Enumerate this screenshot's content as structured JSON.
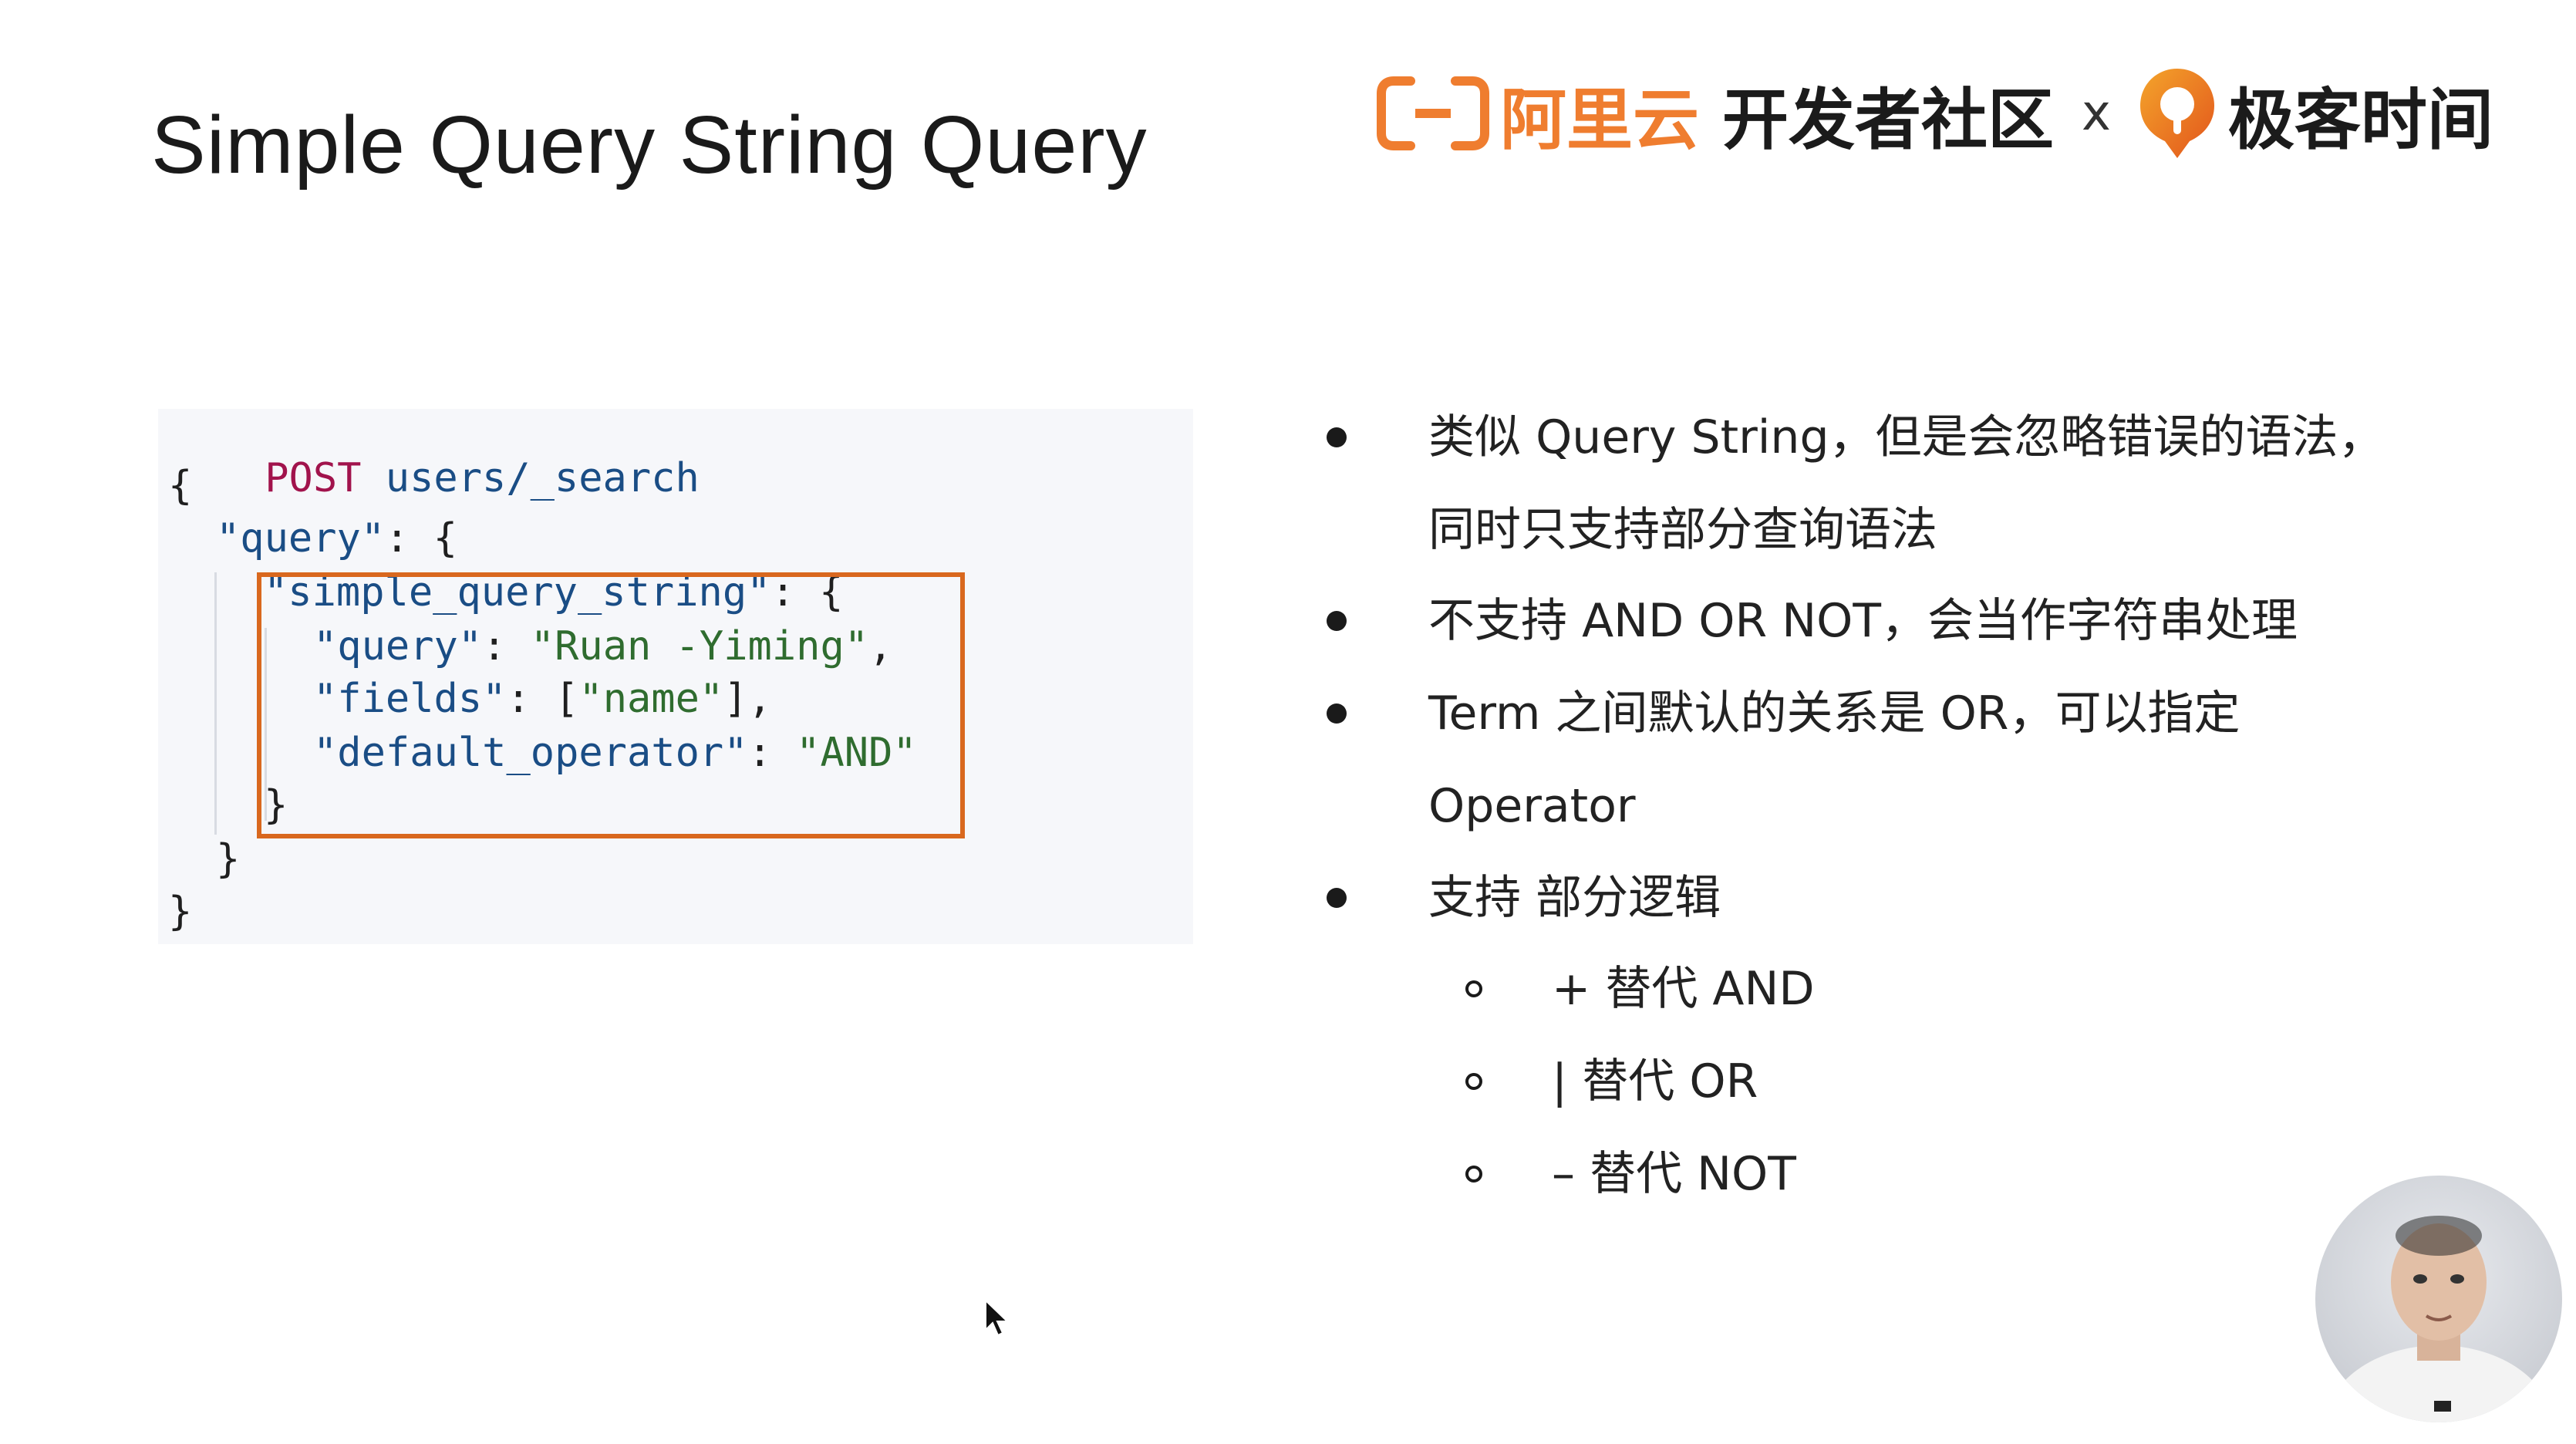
{
  "slide": {
    "title": "Simple Query String Query"
  },
  "header": {
    "aliyun_name": "阿里云",
    "community_name": "开发者社区",
    "times_mark": "x",
    "geektime_name": "极客时间"
  },
  "code": {
    "method": "POST",
    "path": "users/_search",
    "lines": [
      "{",
      "\"query\": {",
      "\"simple_query_string\": {",
      "\"query\": \"Ruan -Yiming\",",
      "\"fields\": [\"name\"],",
      "\"default_operator\": \"AND\"",
      "}",
      "}",
      "}"
    ],
    "tokens": {
      "open_brace": "{",
      "query_key": "\"query\"",
      "colon_brace": ": {",
      "sqs_key": "\"simple_query_string\"",
      "query_key2": "\"query\"",
      "colon": ": ",
      "query_value": "\"Ruan -Yiming\"",
      "comma": ",",
      "fields_key": "\"fields\"",
      "fields_open": "[",
      "fields_value": "\"name\"",
      "fields_close": "],",
      "default_op_key": "\"default_operator\"",
      "default_op_value": "\"AND\"",
      "close_brace": "}"
    }
  },
  "bullets": [
    {
      "text": "类似 Query String，但是会忽略错误的语法，",
      "continuation": "同时只支持部分查询语法"
    },
    {
      "text": "不支持 AND OR NOT，会当作字符串处理"
    },
    {
      "text": "Term 之间默认的关系是 OR，可以指定",
      "continuation": "Operator"
    },
    {
      "text": "支持 部分逻辑"
    }
  ],
  "sub_bullets": [
    {
      "text": "+ 替代 AND"
    },
    {
      "text": "| 替代 OR"
    },
    {
      "text": "– 替代 NOT"
    }
  ],
  "colors": {
    "aliyun_orange": "#ef7d2f",
    "geektime_orange": "#f08a24",
    "highlight_border": "#d9681e",
    "code_bg": "#f6f7fa",
    "keyword": "#a1134c",
    "json_key": "#1a4d85",
    "json_value": "#2f6c2f"
  },
  "icons": {
    "aliyun": "aliyun-bracket-icon",
    "geektime": "geektime-logo-icon",
    "cursor": "mouse-pointer-icon"
  }
}
